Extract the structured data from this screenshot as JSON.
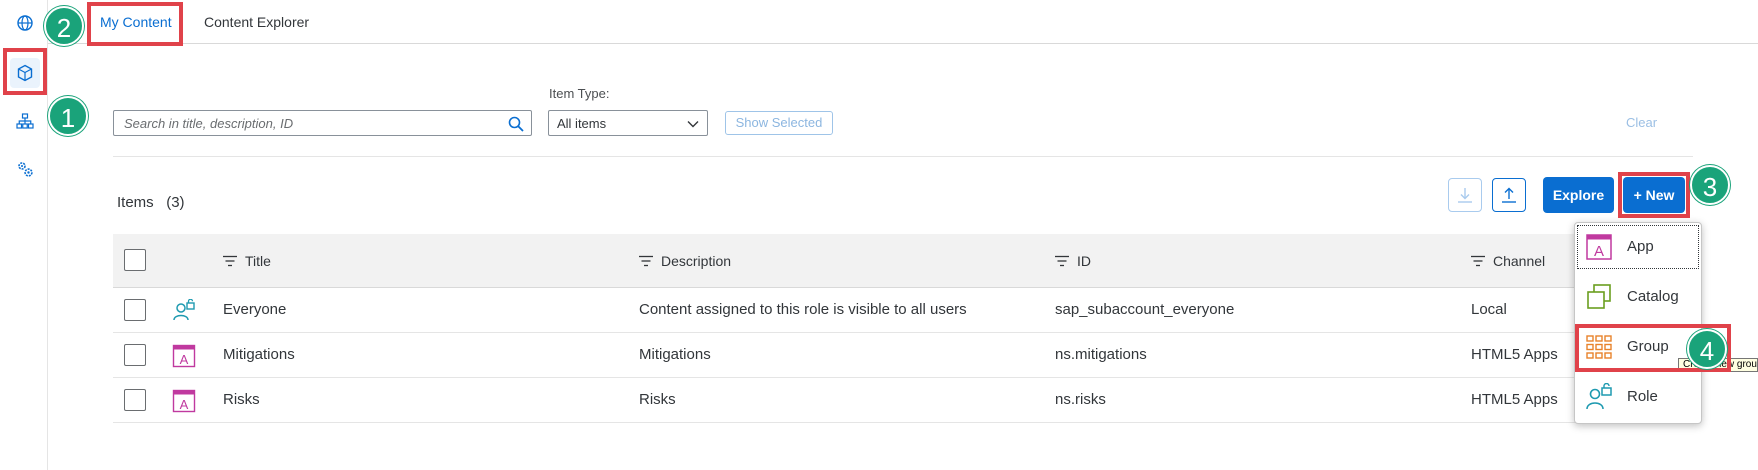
{
  "tabs": [
    {
      "label": "My Content",
      "active": true
    },
    {
      "label": "Content Explorer",
      "active": false
    }
  ],
  "rail": [
    {
      "icon": "globe-icon"
    },
    {
      "icon": "content-cube-icon",
      "selected": true
    },
    {
      "icon": "hierarchy-icon"
    },
    {
      "icon": "settings-gears-icon"
    }
  ],
  "filters": {
    "search_placeholder": "Search in title, description, ID",
    "item_type_label": "Item Type:",
    "item_type_value": "All items",
    "show_selected_label": "Show Selected",
    "clear_label": "Clear"
  },
  "items": {
    "title": "Items",
    "count": "(3)",
    "explore_label": "Explore",
    "new_label": "+ New"
  },
  "table": {
    "columns": [
      "Title",
      "Description",
      "ID",
      "Channel"
    ],
    "rows": [
      {
        "icon": "role-icon",
        "title": "Everyone",
        "description": "Content assigned to this role is visible to all users",
        "id": "sap_subaccount_everyone",
        "channel": "Local"
      },
      {
        "icon": "app-icon",
        "title": "Mitigations",
        "description": "Mitigations",
        "id": "ns.mitigations",
        "channel": "HTML5 Apps"
      },
      {
        "icon": "app-icon",
        "title": "Risks",
        "description": "Risks",
        "id": "ns.risks",
        "channel": "HTML5 Apps"
      }
    ]
  },
  "new_menu": [
    {
      "icon": "app-icon",
      "label": "App"
    },
    {
      "icon": "catalog-icon",
      "label": "Catalog"
    },
    {
      "icon": "group-icon",
      "label": "Group"
    },
    {
      "icon": "role-icon",
      "label": "Role"
    }
  ],
  "tooltip": "Create new group",
  "callouts": [
    "1",
    "2",
    "3",
    "4"
  ],
  "colors": {
    "accent": "#0a6ed1",
    "callout_red": "#e0424a",
    "badge_green": "#1aa37a",
    "app_icon": "#c0399f",
    "role_icon": "#1e9ab0",
    "catalog_icon": "#6b9e1f",
    "group_icon": "#e8822a"
  }
}
